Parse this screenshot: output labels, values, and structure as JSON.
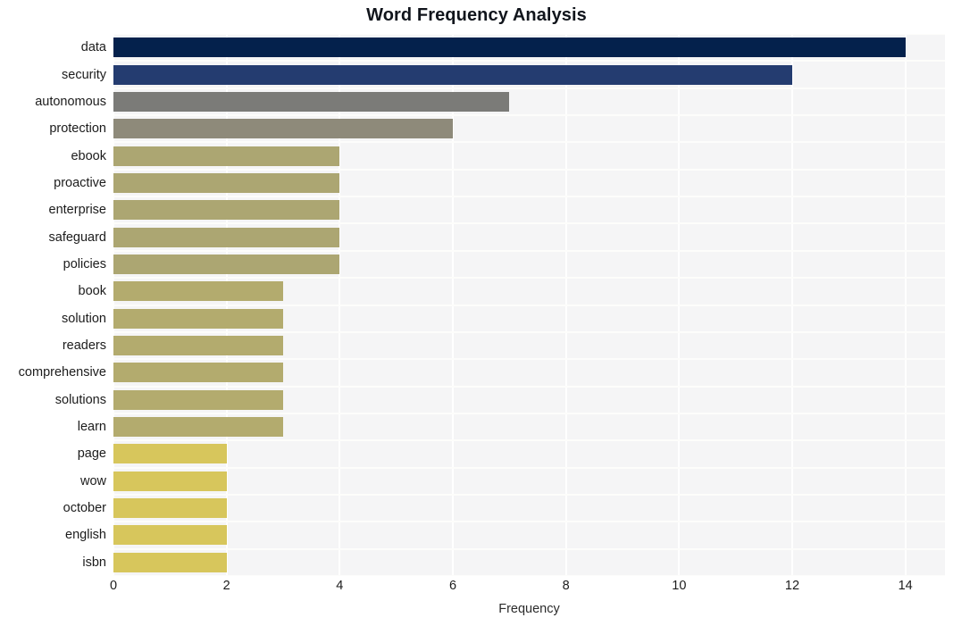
{
  "chart_data": {
    "type": "bar",
    "orientation": "horizontal",
    "title": "Word Frequency Analysis",
    "xlabel": "Frequency",
    "ylabel": "",
    "xlim": [
      0,
      14.7
    ],
    "ylim": [
      0,
      20
    ],
    "grid": true,
    "legend": null,
    "xticks": [
      0,
      2,
      4,
      6,
      8,
      10,
      12,
      14
    ],
    "xtick_labels": [
      "0",
      "2",
      "4",
      "6",
      "8",
      "10",
      "12",
      "14"
    ],
    "categories": [
      "data",
      "security",
      "autonomous",
      "protection",
      "ebook",
      "proactive",
      "enterprise",
      "safeguard",
      "policies",
      "book",
      "solution",
      "readers",
      "comprehensive",
      "solutions",
      "learn",
      "page",
      "wow",
      "october",
      "english",
      "isbn"
    ],
    "values": [
      14,
      12,
      7,
      6,
      4,
      4,
      4,
      4,
      4,
      3,
      3,
      3,
      3,
      3,
      3,
      2,
      2,
      2,
      2,
      2
    ],
    "bar_colors": [
      "#04214c",
      "#243c70",
      "#7b7b78",
      "#8e8a7a",
      "#aca672",
      "#aca672",
      "#aca672",
      "#aca672",
      "#aca672",
      "#b3ab6e",
      "#b3ab6e",
      "#b3ab6e",
      "#b3ab6e",
      "#b3ab6e",
      "#b3ab6e",
      "#d7c65c",
      "#d7c65c",
      "#d7c65c",
      "#d7c65c",
      "#d7c65c"
    ],
    "plot_background": "#f5f5f6",
    "gridline_color": "#ffffff",
    "title_color": "#11151c"
  }
}
